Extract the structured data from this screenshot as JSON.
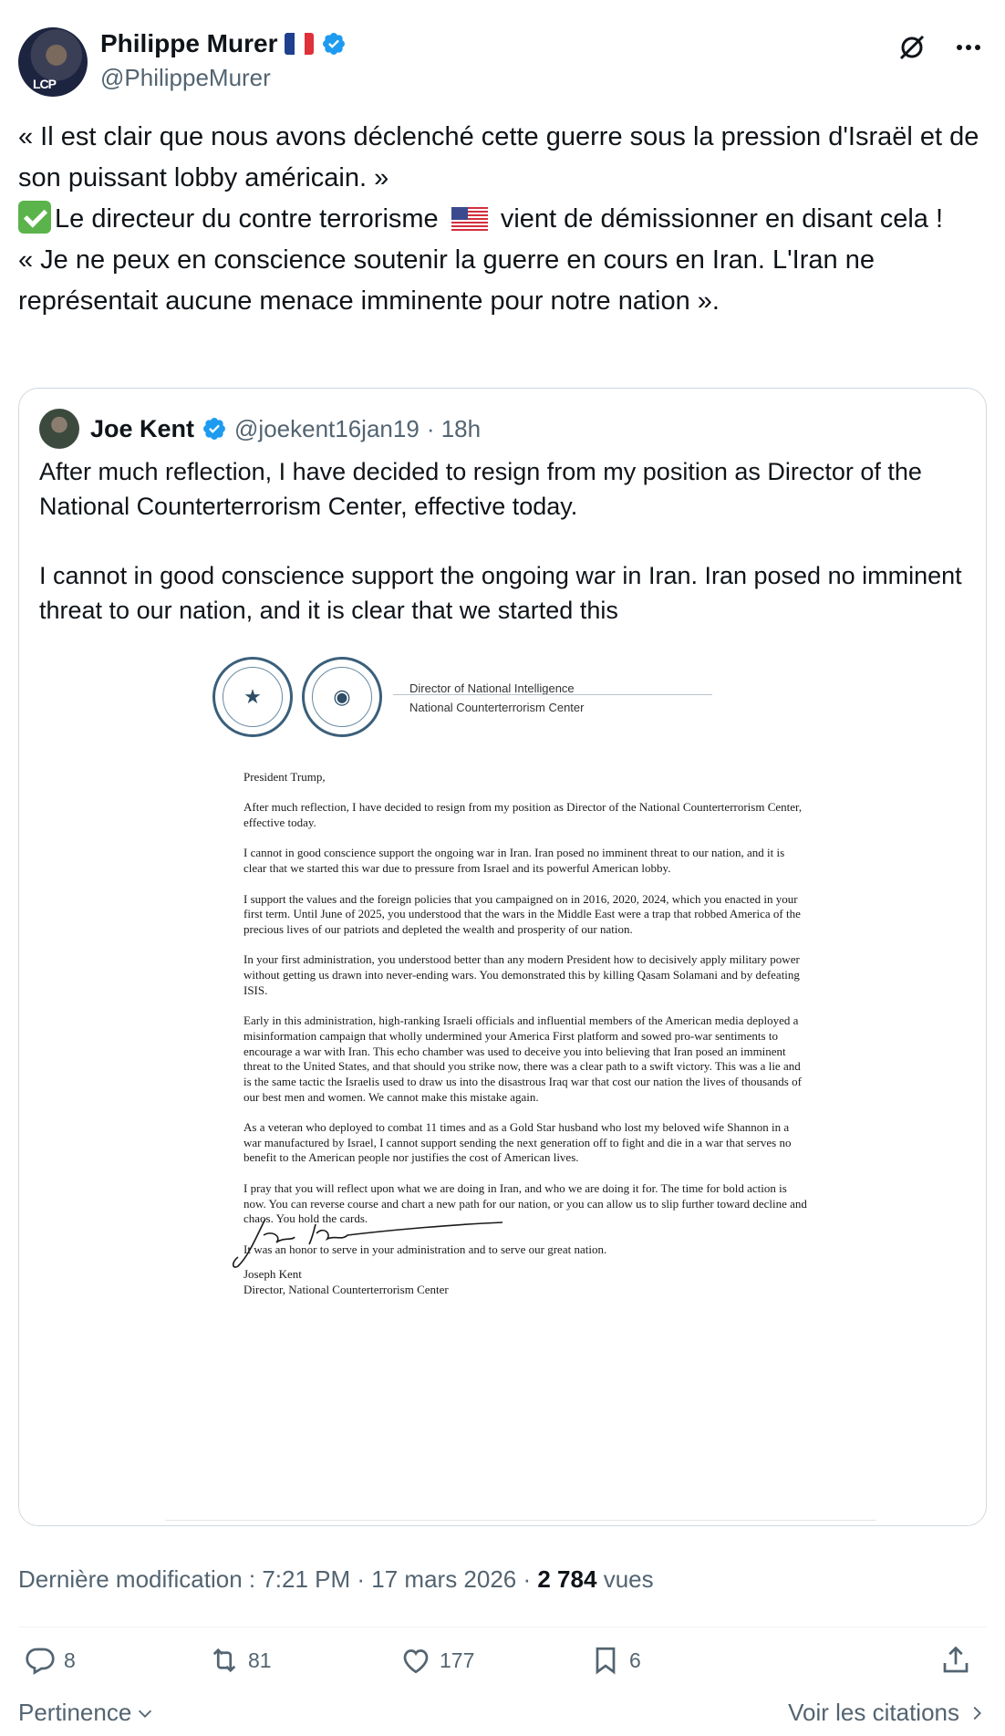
{
  "author": {
    "name": "Philippe Murer",
    "handle": "@PhilippeMurer",
    "avatar_badge": "LCP"
  },
  "tweet": {
    "line1": "« Il est clair que nous avons déclenché cette guerre sous la pression d'Israël et de son puissant lobby américain. »",
    "line2_before_flag": "Le directeur du contre terrorisme",
    "line2_after_flag": "vient de démissionner en disant cela !",
    "line3": "« Je ne peux en conscience soutenir la guerre en cours en Iran. L'Iran ne représentait aucune menace imminente pour notre nation »."
  },
  "quote": {
    "name": "Joe Kent",
    "handle": "@joekent16jan19",
    "time": "· 18h",
    "para1": "After much reflection, I have decided to resign from my position as Director of the National Counterterrorism Center, effective today.",
    "para2": "I cannot in good conscience support the ongoing war in Iran. Iran posed no imminent threat to our nation, and it is clear that we started this"
  },
  "letter": {
    "letterhead_line1": "Director of National Intelligence",
    "letterhead_line2": "National Counterterrorism Center",
    "salutation": "President Trump,",
    "p1": "After much reflection, I have decided to resign from my position as Director of the National Counterterrorism Center, effective today.",
    "p2": "I cannot in good conscience support the ongoing war in Iran. Iran posed no imminent threat to our nation, and it is clear that we started this war due to pressure from Israel and its powerful American lobby.",
    "p3": "I support the values and the foreign policies that you campaigned on in 2016, 2020, 2024, which you enacted in your first term. Until June of 2025, you understood that the wars in the Middle East were a trap that robbed America of the precious lives of our patriots and depleted the wealth and prosperity of our nation.",
    "p4": "In your first administration, you understood better than any modern President how to decisively apply military power without getting us drawn into never-ending wars. You demonstrated this by killing Qasam Solamani and by defeating ISIS.",
    "p5": "Early in this administration, high-ranking Israeli officials and influential members of the American media deployed a misinformation campaign that wholly undermined your America First platform and sowed pro-war sentiments to encourage a war with Iran. This echo chamber was used to deceive you into believing that Iran posed an imminent threat to the United States, and that should you strike now, there was a clear path to a swift victory. This was a lie and is the same tactic the Israelis used to draw us into the disastrous Iraq war that cost our nation the lives of thousands of our best men and women. We cannot make this mistake again.",
    "p6": "As a veteran who deployed to combat 11 times and as a Gold Star husband who lost my beloved wife Shannon in a war manufactured by Israel, I cannot support sending the next generation off to fight and die in a war that serves no benefit to the American people nor justifies the cost of American lives.",
    "p7": "I pray that you will reflect upon what we are doing in Iran, and who we are doing it for. The time for bold action is now. You can reverse course and chart a new path for our nation, or you can allow us to slip further toward decline and chaos. You hold the cards.",
    "p8": "It was an honor to serve in your administration and to serve our great nation.",
    "signature_name": "Joseph Kent",
    "signature_title": "Director, National Counterterrorism Center"
  },
  "meta": {
    "edited_label": "Dernière modification : 7:21 PM · 17 mars 2026 ·",
    "views_count": "2 784",
    "views_label": "vues"
  },
  "actions": {
    "replies": "8",
    "reposts": "81",
    "likes": "177",
    "bookmarks": "6"
  },
  "bottom": {
    "sort_label": "Pertinence",
    "quotes_link": "Voir les citations"
  },
  "colors": {
    "accent": "#1d9bf0",
    "secondary_text": "#536471",
    "primary_text": "#0f1419",
    "border": "#cfd9de"
  },
  "icons": [
    "grok-icon",
    "more-icon",
    "verified-icon",
    "reply-icon",
    "repost-icon",
    "like-icon",
    "bookmark-icon",
    "share-icon",
    "chevron-down-icon",
    "chevron-right-icon"
  ]
}
